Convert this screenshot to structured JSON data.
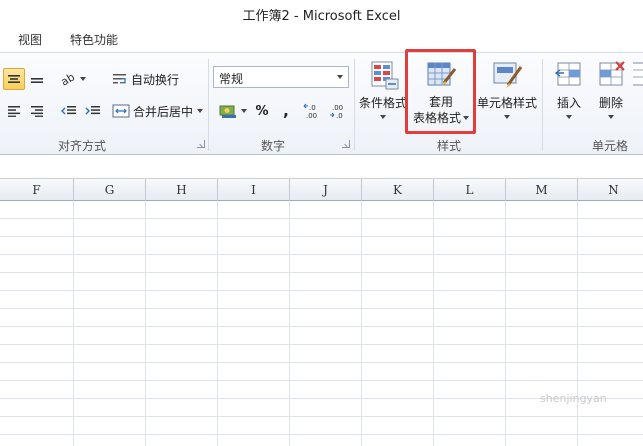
{
  "window": {
    "title": "工作簿2  -  Microsoft Excel"
  },
  "menu": {
    "tabs": [
      "视图",
      "特色功能"
    ]
  },
  "alignment": {
    "wrap_text_label": "自动换行",
    "merge_center_label": "合并后居中",
    "group_label": "对齐方式"
  },
  "number": {
    "format_value": "常规",
    "percent_symbol": "%",
    "comma_symbol": ",",
    "increase_decimal": "←.0 .00",
    "decrease_decimal": ".00 →.0",
    "group_label": "数字"
  },
  "styles": {
    "conditional_label": "条件格式",
    "table_label_line1": "套用",
    "table_label_line2": "表格格式",
    "cell_styles_label": "单元格样式",
    "group_label": "样式"
  },
  "cells": {
    "insert_label": "插入",
    "delete_label": "删除",
    "group_label": "单元格"
  },
  "columns": [
    "F",
    "G",
    "H",
    "I",
    "J",
    "K",
    "L",
    "M",
    "N"
  ],
  "watermark": "shenjingyan",
  "colors": {
    "highlight": "#e03d3d",
    "active_button": "#f8cf5c",
    "ribbon_bg": "#eef2f8"
  }
}
